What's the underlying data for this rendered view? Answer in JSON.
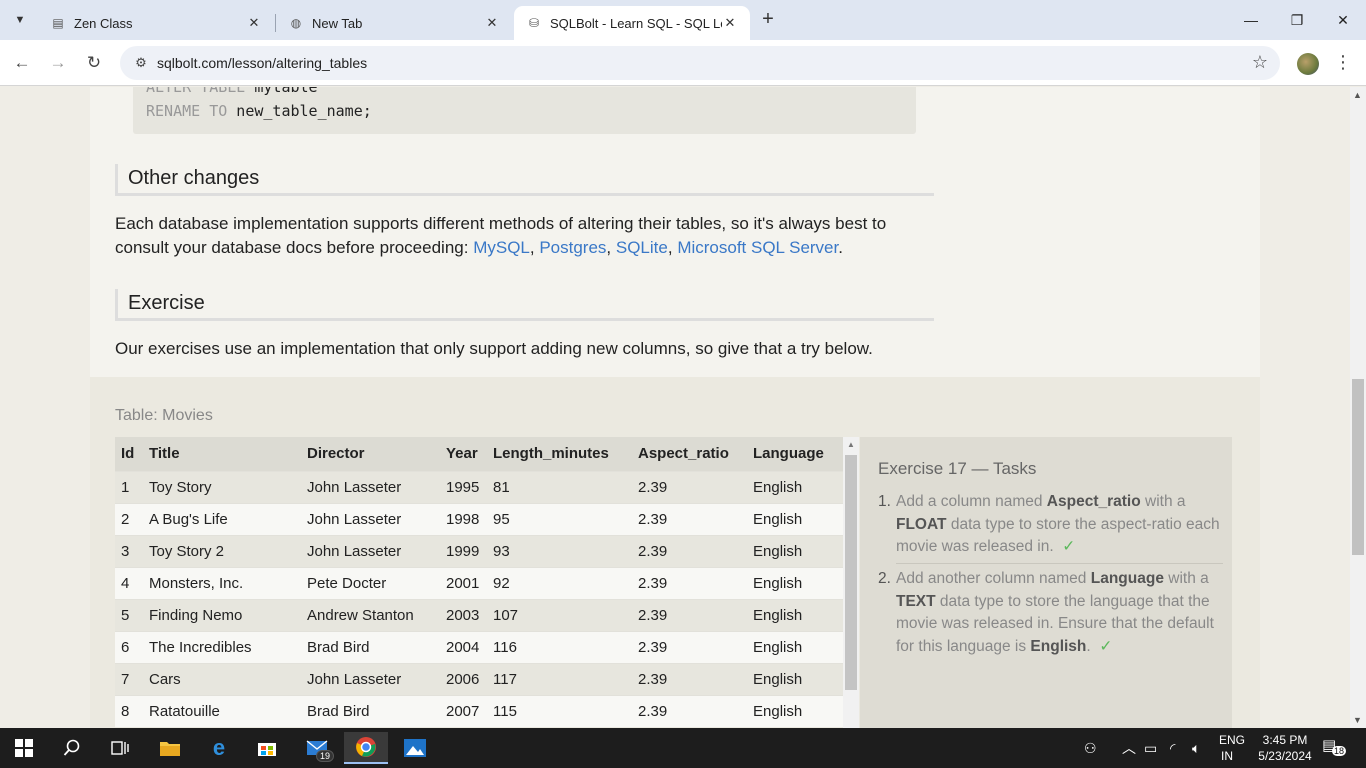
{
  "browser": {
    "tabs": [
      {
        "label": "Zen Class",
        "icon": "zen-class-favicon",
        "active": false
      },
      {
        "label": "New Tab",
        "icon": "chrome-favicon",
        "active": false
      },
      {
        "label": "SQLBolt - Learn SQL - SQL Less",
        "icon": "database-favicon",
        "active": true
      }
    ],
    "url": "sqlbolt.com/lesson/altering_tables"
  },
  "page": {
    "code": {
      "line1_kw": "ALTER TABLE",
      "line1_ident": " mytable",
      "line2_kw": "RENAME TO",
      "line2_ident": " new_table_name;"
    },
    "other_changes": {
      "heading": "Other changes",
      "text": "Each database implementation supports different methods of altering their tables, so it's always best to consult your database docs before proceeding: ",
      "links": [
        "MySQL",
        "Postgres",
        "SQLite",
        "Microsoft SQL Server"
      ],
      "sep": ", ",
      "end": "."
    },
    "exercise": {
      "heading": "Exercise",
      "text": "Our exercises use an implementation that only support adding new columns, so give that a try below."
    },
    "table": {
      "caption": "Table: Movies",
      "columns": [
        "Id",
        "Title",
        "Director",
        "Year",
        "Length_minutes",
        "Aspect_ratio",
        "Language"
      ],
      "rows": [
        [
          "1",
          "Toy Story",
          "John Lasseter",
          "1995",
          "81",
          "2.39",
          "English"
        ],
        [
          "2",
          "A Bug's Life",
          "John Lasseter",
          "1998",
          "95",
          "2.39",
          "English"
        ],
        [
          "3",
          "Toy Story 2",
          "John Lasseter",
          "1999",
          "93",
          "2.39",
          "English"
        ],
        [
          "4",
          "Monsters, Inc.",
          "Pete Docter",
          "2001",
          "92",
          "2.39",
          "English"
        ],
        [
          "5",
          "Finding Nemo",
          "Andrew Stanton",
          "2003",
          "107",
          "2.39",
          "English"
        ],
        [
          "6",
          "The Incredibles",
          "Brad Bird",
          "2004",
          "116",
          "2.39",
          "English"
        ],
        [
          "7",
          "Cars",
          "John Lasseter",
          "2006",
          "117",
          "2.39",
          "English"
        ],
        [
          "8",
          "Ratatouille",
          "Brad Bird",
          "2007",
          "115",
          "2.39",
          "English"
        ]
      ]
    },
    "tasks": {
      "title": "Exercise 17 — Tasks",
      "items": [
        {
          "num": "1.",
          "a": "Add a column named ",
          "b1": "Aspect_ratio",
          "c": " with a ",
          "b2": "FLOAT",
          "d": " data type to store the aspect-ratio each movie was released in.",
          "check": "✓"
        },
        {
          "num": "2.",
          "a": "Add another column named ",
          "b1": "Language",
          "c": " with a ",
          "b2": "TEXT",
          "d": " data type to store the language that the movie was released in. Ensure that the default for this language is ",
          "b3": "English",
          "e": ".",
          "check": "✓"
        }
      ]
    }
  },
  "taskbar": {
    "mail_badge": "19",
    "lang_line1": "ENG",
    "lang_line2": "IN",
    "time": "3:45 PM",
    "date": "5/23/2024",
    "notif_badge": "18"
  },
  "colors": {
    "link": "#3a78c7",
    "check": "#5cb85c",
    "tab_strip": "#dfe6f2",
    "taskbar": "#1d1d1d"
  }
}
